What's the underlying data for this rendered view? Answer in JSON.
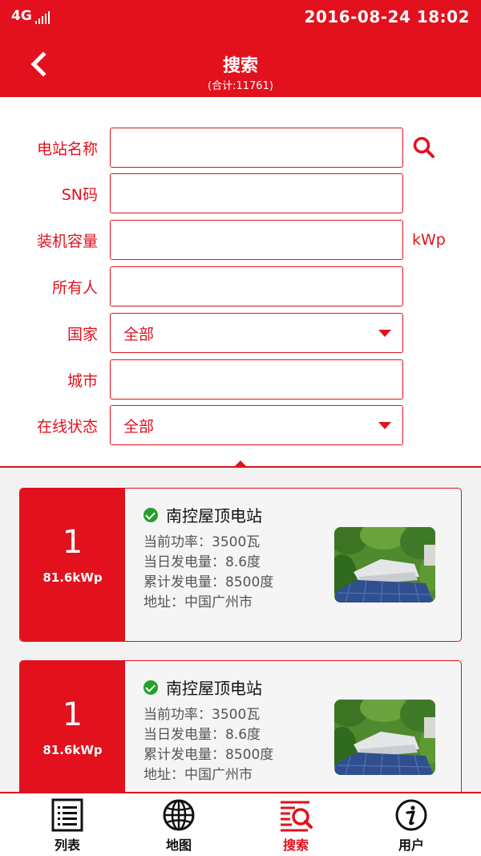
{
  "status": {
    "network": "4G",
    "datetime": "2016-08-24 18:02"
  },
  "header": {
    "title": "搜索",
    "subtitle": "(合计:11761)"
  },
  "colors": {
    "accent": "#e2111d",
    "online": "#25a12a"
  },
  "form": {
    "station_name": {
      "label": "电站名称",
      "value": ""
    },
    "sn": {
      "label": "SN码",
      "value": ""
    },
    "capacity": {
      "label": "装机容量",
      "value": "",
      "unit": "kWp"
    },
    "owner": {
      "label": "所有人",
      "value": ""
    },
    "country": {
      "label": "国家",
      "selected": "全部"
    },
    "city": {
      "label": "城市",
      "value": ""
    },
    "online_status": {
      "label": "在线状态",
      "selected": "全部"
    }
  },
  "results": [
    {
      "count": "1",
      "capacity": "81.6kWp",
      "name": "南控屋顶电站",
      "status": "online",
      "power": "当前功率：3500瓦",
      "daily": "当日发电量：8.6度",
      "total": "累计发电量：8500度",
      "address": "地址：中国广州市"
    },
    {
      "count": "1",
      "capacity": "81.6kWp",
      "name": "南控屋顶电站",
      "status": "online",
      "power": "当前功率：3500瓦",
      "daily": "当日发电量：8.6度",
      "total": "累计发电量：8500度",
      "address": "地址：中国广州市"
    }
  ],
  "tabs": [
    {
      "label": "列表",
      "icon": "list-icon"
    },
    {
      "label": "地图",
      "icon": "globe-icon"
    },
    {
      "label": "搜索",
      "icon": "search-list-icon",
      "active": true
    },
    {
      "label": "用户",
      "icon": "info-icon"
    }
  ]
}
